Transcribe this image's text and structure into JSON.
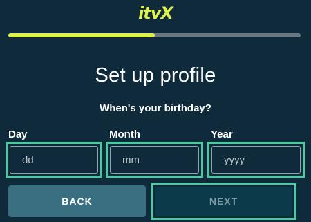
{
  "brand": {
    "logo_text": "itvX",
    "accent": "#dcf24a",
    "focus": "#4cc9a0",
    "background": "#0f2a3a"
  },
  "progress": {
    "fraction": 0.5
  },
  "page": {
    "title": "Set up profile",
    "question": "When's your birthday?"
  },
  "fields": [
    {
      "label": "Day",
      "placeholder": "dd"
    },
    {
      "label": "Month",
      "placeholder": "mm"
    },
    {
      "label": "Year",
      "placeholder": "yyyy"
    }
  ],
  "buttons": {
    "back": "BACK",
    "next": "NEXT"
  }
}
